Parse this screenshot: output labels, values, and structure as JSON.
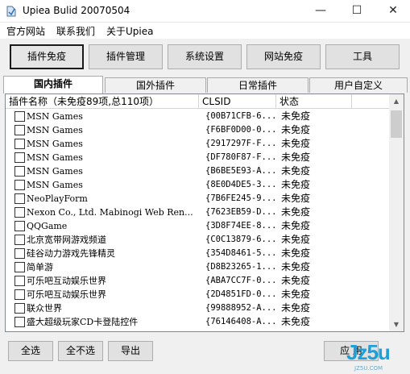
{
  "window": {
    "title": "Upiea Bulid 20070504",
    "minimize_glyph": "—",
    "maximize_glyph": "☐",
    "close_glyph": "✕"
  },
  "menu": [
    "官方网站",
    "联系我们",
    "关于Upiea"
  ],
  "toolbar": [
    {
      "label": "插件免疫",
      "active": true
    },
    {
      "label": "插件管理",
      "active": false
    },
    {
      "label": "系统设置",
      "active": false
    },
    {
      "label": "网站免疫",
      "active": false
    },
    {
      "label": "工具",
      "active": false
    }
  ],
  "tabs": [
    {
      "label": "国内插件",
      "active": true
    },
    {
      "label": "国外插件",
      "active": false
    },
    {
      "label": "日常插件",
      "active": false
    },
    {
      "label": "用户自定义",
      "active": false
    }
  ],
  "list": {
    "columns": [
      "插件名称（未免疫89项,总110项）",
      "CLSID",
      "状态"
    ],
    "rows": [
      {
        "name": "MSN Games",
        "clsid": "{00B71CFB-6...",
        "status": "未免疫"
      },
      {
        "name": "MSN Games",
        "clsid": "{F6BF0D00-0...",
        "status": "未免疫"
      },
      {
        "name": "MSN Games",
        "clsid": "{2917297F-F...",
        "status": "未免疫"
      },
      {
        "name": "MSN Games",
        "clsid": "{DF780F87-F...",
        "status": "未免疫"
      },
      {
        "name": "MSN Games",
        "clsid": "{B6BE5E93-A...",
        "status": "未免疫"
      },
      {
        "name": "MSN Games",
        "clsid": "{8E0D4DE5-3...",
        "status": "未免疫"
      },
      {
        "name": "NeoPlayForm",
        "clsid": "{7B6FE245-9...",
        "status": "未免疫"
      },
      {
        "name": "Nexon Co., Ltd. Mabinogi Web Ren...",
        "clsid": "{7623EB59-D...",
        "status": "未免疫"
      },
      {
        "name": "QQGame",
        "clsid": "{3D8F74EE-8...",
        "status": "未免疫"
      },
      {
        "name": "北京宽带网游戏频道",
        "clsid": "{C0C13879-6...",
        "status": "未免疫"
      },
      {
        "name": "硅谷动力游戏先锋精灵",
        "clsid": "{354D8461-5...",
        "status": "未免疫"
      },
      {
        "name": "简单游",
        "clsid": "{D8B23265-1...",
        "status": "未免疫"
      },
      {
        "name": "可乐吧互动娱乐世界",
        "clsid": "{ABA7CC7F-0...",
        "status": "未免疫"
      },
      {
        "name": "可乐吧互动娱乐世界",
        "clsid": "{2D4851FD-0...",
        "status": "未免疫"
      },
      {
        "name": "联众世界",
        "clsid": "{99888952-A...",
        "status": "未免疫"
      },
      {
        "name": "盛大超级玩家CD卡登陆控件",
        "clsid": "{76146408-A...",
        "status": "未免疫"
      }
    ]
  },
  "scrollbar": {
    "up_glyph": "▲",
    "down_glyph": "▼"
  },
  "bottom_buttons": [
    "全选",
    "全不选",
    "导出",
    "应 用"
  ],
  "watermark": {
    "text": "Jz5u",
    "sub": "JZ5U.COM"
  },
  "colors": {
    "accent": "#1e9fd8",
    "window_bg": "#f0f0f0"
  }
}
